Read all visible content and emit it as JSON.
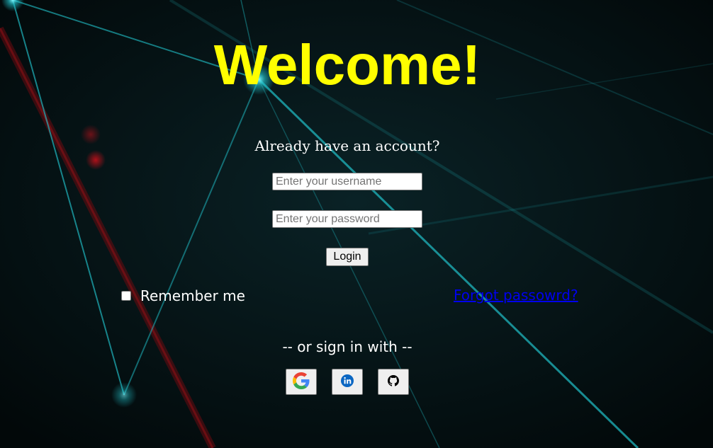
{
  "title": "Welcome!",
  "subtitle": "Already have an account?",
  "username": {
    "placeholder": "Enter your username",
    "value": ""
  },
  "password": {
    "placeholder": "Enter your password",
    "value": ""
  },
  "login_label": "Login",
  "remember": {
    "label": "Remember me",
    "checked": false
  },
  "forgot_label": "Forgot passowrd?",
  "divider": "-- or sign in with --",
  "social": [
    {
      "icon": "google-icon"
    },
    {
      "icon": "linkedin-icon"
    },
    {
      "icon": "github-icon"
    }
  ],
  "colors": {
    "title": "#ffff00",
    "background": "#030b0d",
    "link": "#0000ee",
    "line_accent": "#1fb5bd"
  }
}
